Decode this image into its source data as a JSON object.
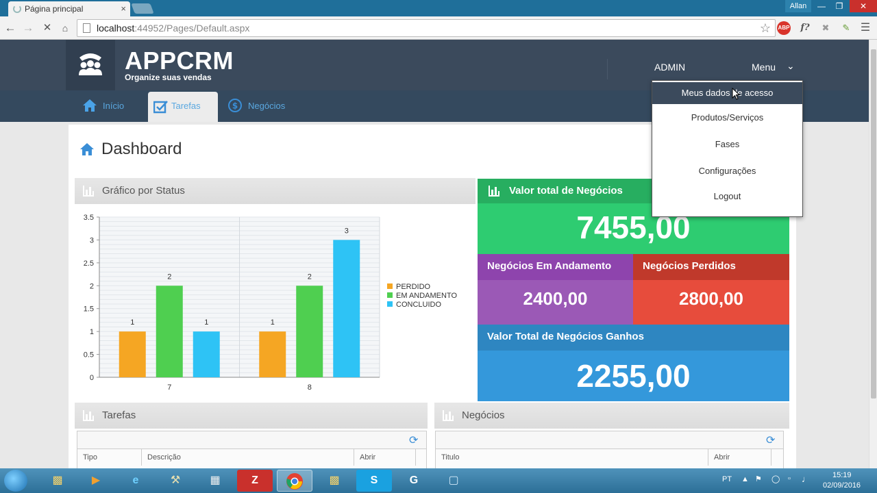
{
  "browser": {
    "tab_title": "Página principal",
    "tab_close": "×",
    "url_host": "localhost",
    "url_rest": ":44952/Pages/Default.aspx",
    "window_user": "Allan",
    "abp_label": "ABP",
    "ext_f_label": "f?"
  },
  "app": {
    "title": "APPCRM",
    "subtitle": "Organize suas vendas",
    "admin_label": "ADMIN",
    "menu_label": "Menu"
  },
  "nav": {
    "tabs": [
      {
        "label": "Início",
        "icon": "home-icon"
      },
      {
        "label": "Tarefas",
        "icon": "checkbox-icon",
        "active": true
      },
      {
        "label": "Negócios",
        "icon": "dollar-icon"
      }
    ]
  },
  "page": {
    "title": "Dashboard"
  },
  "chart_panel": {
    "title": "Gráfico por Status"
  },
  "chart_data": {
    "type": "bar",
    "categories": [
      "7",
      "8"
    ],
    "series": [
      {
        "name": "PERDIDO",
        "values": [
          1,
          1
        ],
        "color": "#f5a623"
      },
      {
        "name": "EM ANDAMENTO",
        "values": [
          2,
          2
        ],
        "color": "#4fcf50"
      },
      {
        "name": "CONCLUIDO",
        "values": [
          1,
          3
        ],
        "color": "#2ec3f5"
      }
    ],
    "ylim": [
      0,
      3.5
    ],
    "yticks": [
      "3.5",
      "3",
      "2.5",
      "2",
      "1.5",
      "1",
      "0.5",
      "0"
    ],
    "data_labels": true,
    "legend": "right",
    "grid": true
  },
  "metrics": {
    "total_header": "Valor total de Negócios",
    "total_value": "7455,00",
    "andamento_header": "Negócios Em Andamento",
    "andamento_value": "2400,00",
    "perdidos_header": "Negócios Perdidos",
    "perdidos_value": "2800,00",
    "ganhos_header": "Valor Total de Negócios Ganhos",
    "ganhos_value": "2255,00",
    "colors": {
      "green": "#2ecc71",
      "purple": "#9b59b6",
      "red": "#e74c3c",
      "blue": "#3498db"
    }
  },
  "tarefas": {
    "title": "Tarefas",
    "columns": [
      "Tipo",
      "Descrição",
      "Abrir"
    ]
  },
  "negocios": {
    "title": "Negócios",
    "columns": [
      "Titulo",
      "Abrir"
    ]
  },
  "dropdown": {
    "items": [
      {
        "label": "Meus dados de acesso",
        "hover": true
      },
      {
        "label": "Produtos/Serviços"
      },
      {
        "label": "Fases"
      },
      {
        "label": "Configurações"
      },
      {
        "label": "Logout"
      }
    ]
  },
  "taskbar": {
    "lang": "PT",
    "time": "15:19",
    "date": "02/09/2016"
  }
}
